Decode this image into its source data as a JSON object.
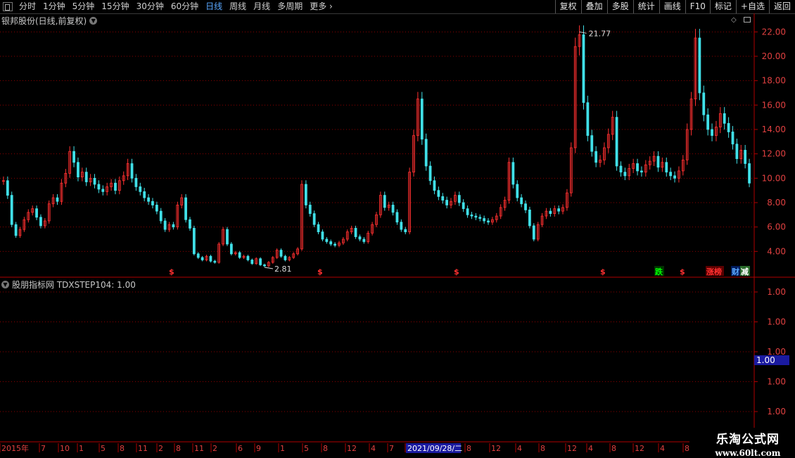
{
  "toolbar": {
    "periods": [
      "分时",
      "1分钟",
      "5分钟",
      "15分钟",
      "30分钟",
      "60分钟",
      "日线",
      "周线",
      "月线",
      "多周期",
      "更多"
    ],
    "active_period": "日线",
    "right_buttons": [
      "复权",
      "叠加",
      "多股",
      "统计",
      "画线",
      "F10",
      "标记",
      "+自选",
      "返回"
    ]
  },
  "main_chart": {
    "title": "银邦股份(日线,前复权)",
    "price_axis": [
      "22.00",
      "20.00",
      "18.00",
      "16.00",
      "14.00",
      "12.00",
      "10.00",
      "8.00",
      "6.00",
      "4.00"
    ],
    "high_label": "21.77",
    "low_label": "2.81",
    "markers": [
      "$",
      "$",
      "$",
      "$",
      "跌",
      "$",
      "涨榜",
      "财",
      "减"
    ]
  },
  "indicator": {
    "title": "股朋指标网 TDXSTEP104: 1.00",
    "axis": [
      "1.00",
      "1.00",
      "1.00",
      "1.00",
      "1.00"
    ],
    "current_value": "1.00"
  },
  "time_axis": {
    "labels": [
      "2015年",
      "7",
      "10",
      "1",
      "5",
      "8",
      "11",
      "2",
      "8",
      "11",
      "2",
      "6",
      "9",
      "1",
      "5",
      "8",
      "12",
      "4",
      "7",
      "2021/09/28/二",
      "8",
      "12",
      "4",
      "8",
      "12",
      "4",
      "8",
      "12",
      "4",
      "8"
    ]
  },
  "watermark": {
    "line1": "乐淘公式网",
    "line2": "www.60lt.com"
  },
  "colors": {
    "up": "#ff3030",
    "down": "#40e0e8",
    "grid": "#8b0000",
    "accent": "#5aa8ff"
  },
  "chart_data": {
    "type": "candlestick",
    "ylim": [
      2,
      23
    ],
    "close_series": [
      9.8,
      8.6,
      6.2,
      5.3,
      5.8,
      6.6,
      7.2,
      7.5,
      6.8,
      6.1,
      6.5,
      7.9,
      8.4,
      8.1,
      9.6,
      10.4,
      12.2,
      11.3,
      10.1,
      10.5,
      9.7,
      10.0,
      9.5,
      9.1,
      8.9,
      9.3,
      9.6,
      9.0,
      9.8,
      10.2,
      11.2,
      10.0,
      9.3,
      8.9,
      8.4,
      8.1,
      7.8,
      7.3,
      6.5,
      5.8,
      6.2,
      6.0,
      7.8,
      8.4,
      6.6,
      5.9,
      3.8,
      3.5,
      3.3,
      3.6,
      3.2,
      3.1,
      4.6,
      5.8,
      4.6,
      3.8,
      3.9,
      3.5,
      3.6,
      3.3,
      3.0,
      3.4,
      2.9,
      2.81,
      3.1,
      3.5,
      4.1,
      3.6,
      3.3,
      3.5,
      3.8,
      4.2,
      9.5,
      7.8,
      7.1,
      6.2,
      5.6,
      5.0,
      4.8,
      4.6,
      4.5,
      4.7,
      5.0,
      5.6,
      5.9,
      5.2,
      5.0,
      4.8,
      5.5,
      6.2,
      7.0,
      8.6,
      7.6,
      7.8,
      7.2,
      6.4,
      5.8,
      5.6,
      10.5,
      13.5,
      16.5,
      13.2,
      11.0,
      9.8,
      9.0,
      8.5,
      8.2,
      7.8,
      8.1,
      8.6,
      8.0,
      7.5,
      7.0,
      6.9,
      6.8,
      6.7,
      6.5,
      6.4,
      6.6,
      6.9,
      7.6,
      8.2,
      11.3,
      9.5,
      8.4,
      7.9,
      7.4,
      6.1,
      5.0,
      6.2,
      6.9,
      7.3,
      7.1,
      7.5,
      7.3,
      7.6,
      8.8,
      12.5,
      20.8,
      21.77,
      16.2,
      13.5,
      12.2,
      11.3,
      11.5,
      12.5,
      13.6,
      15.0,
      11.0,
      10.5,
      10.2,
      10.8,
      11.2,
      10.6,
      10.5,
      11.1,
      11.4,
      11.8,
      10.9,
      11.3,
      10.5,
      10.2,
      10.0,
      10.6,
      11.5,
      14.0,
      16.5,
      21.5,
      17.0,
      15.2,
      14.0,
      13.5,
      14.2,
      15.3,
      14.5,
      13.8,
      12.8,
      11.6,
      12.3,
      11.2,
      9.6
    ]
  }
}
